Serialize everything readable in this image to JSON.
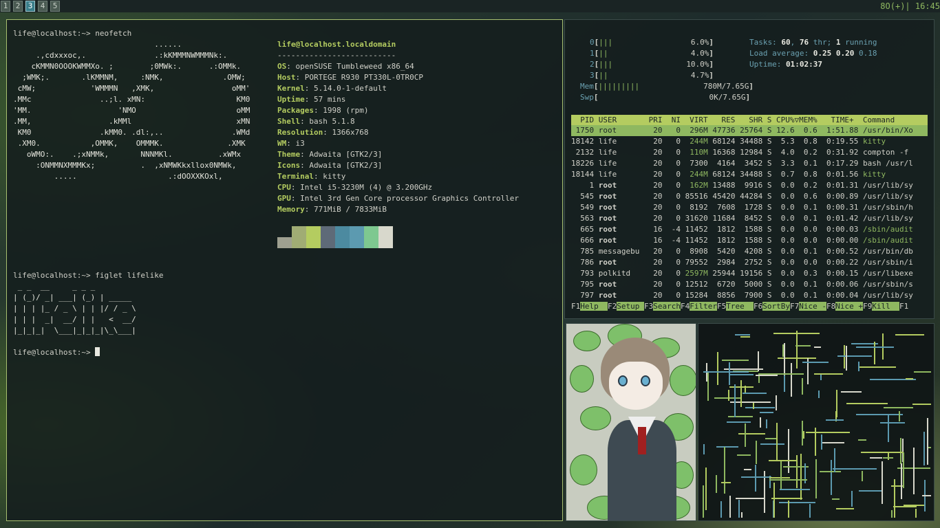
{
  "topbar": {
    "workspaces": [
      "1",
      "2",
      "3",
      "4",
      "5"
    ],
    "active_workspace": 3,
    "status": "8O(+)| 16:45"
  },
  "terminal": {
    "prompt1": "life@localhost:~> neofetch",
    "ascii_art": [
      "                               ......",
      "     .,cdxxxoc,.               .:kKMMMNWMMMNk:.",
      "    cKMMN0OOOKWMMXo. ;        ;0MWk:.      .:OMMk.",
      "  ;WMK;.       .lKMMNM,     :NMK,             .OMW;",
      " cMW;            'WMMMN   ,XMK,                 oMM'",
      ".MMc               ..;l. xMN:                    KM0",
      "'MM.                   'NMO                      oMM",
      ".MM,                 .kMMl                       xMN",
      " KM0               .kMM0. .dl:,..               .WMd",
      " .XM0.           ,OMMK,    OMMMK.              .XMK",
      "   oWMO:.    .;xNMMk,       NNNMKl.          .xWMx",
      "     :ONMMNXMMMKx;          .  ,xNMWKkxllox0NMWk,",
      "         .....                    .:dOOXXKOxl,"
    ],
    "info_title": "life@localhost.localdomain",
    "info_sep": "--------------------------",
    "info": [
      {
        "label": "OS",
        "value": "openSUSE Tumbleweed x86_64"
      },
      {
        "label": "Host",
        "value": "PORTEGE R930 PT330L-0TR0CP"
      },
      {
        "label": "Kernel",
        "value": "5.14.0-1-default"
      },
      {
        "label": "Uptime",
        "value": "57 mins"
      },
      {
        "label": "Packages",
        "value": "1998 (rpm)"
      },
      {
        "label": "Shell",
        "value": "bash 5.1.8"
      },
      {
        "label": "Resolution",
        "value": "1366x768"
      },
      {
        "label": "WM",
        "value": "i3"
      },
      {
        "label": "Theme",
        "value": "Adwaita [GTK2/3]"
      },
      {
        "label": "Icons",
        "value": "Adwaita [GTK2/3]"
      },
      {
        "label": "Terminal",
        "value": "kitty"
      },
      {
        "label": "CPU",
        "value": "Intel i5-3230M (4) @ 3.200GHz"
      },
      {
        "label": "GPU",
        "value": "Intel 3rd Gen Core processor Graphics Controller"
      },
      {
        "label": "Memory",
        "value": "771MiB / 7833MiB"
      }
    ],
    "swatches": [
      "#9ea090",
      "#a0ac74",
      "#b4cc60",
      "#5e6a78",
      "#4c8aa0",
      "#5c9ab0",
      "#7ec890",
      "#d8d8cc"
    ],
    "prompt2": "life@localhost:~> figlet lifelike",
    "figlet": [
      " _ _  __     _ _ _",
      "| (_)/ _| ___| (_) | _____",
      "| | | |_ / _ \\ | | |/ / _ \\",
      "| | |  _|  __/ | |   <  __/",
      "|_|_|_|  \\___|_|_|_|\\_\\___|"
    ],
    "prompt3": "life@localhost:~> "
  },
  "htop": {
    "cpus": [
      {
        "idx": "0",
        "bar": "|||",
        "pct": "6.0%"
      },
      {
        "idx": "1",
        "bar": "||",
        "pct": "4.0%"
      },
      {
        "idx": "2",
        "bar": "|||",
        "pct": "10.0%"
      },
      {
        "idx": "3",
        "bar": "||",
        "pct": "4.7%"
      }
    ],
    "mem": {
      "label": "Mem",
      "bar": "|||||||||",
      "value": "780M/7.65G"
    },
    "swp": {
      "label": "Swp",
      "bar": "",
      "value": "0K/7.65G"
    },
    "tasks_label": "Tasks: ",
    "tasks_a": "60",
    "tasks_sep": ", ",
    "tasks_b": "76",
    "tasks_mid": " thr; ",
    "tasks_c": "1",
    "tasks_end": " running",
    "load_label": "Load average: ",
    "load_1": "0.25",
    "load_2": "0.20",
    "load_3": "0.18",
    "uptime_label": "Uptime: ",
    "uptime": "01:02:37",
    "header": "  PID USER       PRI  NI  VIRT   RES   SHR S CPU%▽MEM%   TIME+  Command",
    "processes": [
      {
        "pid": "1750",
        "user": "root",
        "pri": "20",
        "ni": "0",
        "virt": "296M",
        "res": "47736",
        "shr": "25764",
        "s": "S",
        "cpu": "12.6",
        "mem": "0.6",
        "time": "1:51.88",
        "cmd": "/usr/bin/Xo"
      },
      {
        "pid": "18142",
        "user": "life",
        "pri": "20",
        "ni": "0",
        "virt": "244M",
        "res": "68124",
        "shr": "34488",
        "s": "S",
        "cpu": "5.3",
        "mem": "0.8",
        "time": "0:19.55",
        "cmd": "kitty"
      },
      {
        "pid": "2132",
        "user": "life",
        "pri": "20",
        "ni": "0",
        "virt": "110M",
        "res": "16368",
        "shr": "12984",
        "s": "S",
        "cpu": "4.0",
        "mem": "0.2",
        "time": "0:31.92",
        "cmd": "compton -f"
      },
      {
        "pid": "18226",
        "user": "life",
        "pri": "20",
        "ni": "0",
        "virt": "7300",
        "res": "4164",
        "shr": "3452",
        "s": "S",
        "cpu": "3.3",
        "mem": "0.1",
        "time": "0:17.29",
        "cmd": "bash /usr/l"
      },
      {
        "pid": "18144",
        "user": "life",
        "pri": "20",
        "ni": "0",
        "virt": "244M",
        "res": "68124",
        "shr": "34488",
        "s": "S",
        "cpu": "0.7",
        "mem": "0.8",
        "time": "0:01.56",
        "cmd": "kitty"
      },
      {
        "pid": "1",
        "user": "root",
        "pri": "20",
        "ni": "0",
        "virt": "162M",
        "res": "13488",
        "shr": "9916",
        "s": "S",
        "cpu": "0.0",
        "mem": "0.2",
        "time": "0:01.31",
        "cmd": "/usr/lib/sy"
      },
      {
        "pid": "545",
        "user": "root",
        "pri": "20",
        "ni": "0",
        "virt": "85516",
        "res": "45420",
        "shr": "44284",
        "s": "S",
        "cpu": "0.0",
        "mem": "0.6",
        "time": "0:00.89",
        "cmd": "/usr/lib/sy"
      },
      {
        "pid": "549",
        "user": "root",
        "pri": "20",
        "ni": "0",
        "virt": "8192",
        "res": "7608",
        "shr": "1728",
        "s": "S",
        "cpu": "0.0",
        "mem": "0.1",
        "time": "0:00.31",
        "cmd": "/usr/sbin/h"
      },
      {
        "pid": "563",
        "user": "root",
        "pri": "20",
        "ni": "0",
        "virt": "31620",
        "res": "11684",
        "shr": "8452",
        "s": "S",
        "cpu": "0.0",
        "mem": "0.1",
        "time": "0:01.42",
        "cmd": "/usr/lib/sy"
      },
      {
        "pid": "665",
        "user": "root",
        "pri": "16",
        "ni": "-4",
        "virt": "11452",
        "res": "1812",
        "shr": "1588",
        "s": "S",
        "cpu": "0.0",
        "mem": "0.0",
        "time": "0:00.03",
        "cmd": "/sbin/audit"
      },
      {
        "pid": "666",
        "user": "root",
        "pri": "16",
        "ni": "-4",
        "virt": "11452",
        "res": "1812",
        "shr": "1588",
        "s": "S",
        "cpu": "0.0",
        "mem": "0.0",
        "time": "0:00.00",
        "cmd": "/sbin/audit"
      },
      {
        "pid": "785",
        "user": "messagebu",
        "pri": "20",
        "ni": "0",
        "virt": "8908",
        "res": "5420",
        "shr": "4208",
        "s": "S",
        "cpu": "0.0",
        "mem": "0.1",
        "time": "0:00.52",
        "cmd": "/usr/bin/db"
      },
      {
        "pid": "786",
        "user": "root",
        "pri": "20",
        "ni": "0",
        "virt": "79552",
        "res": "2984",
        "shr": "2752",
        "s": "S",
        "cpu": "0.0",
        "mem": "0.0",
        "time": "0:00.22",
        "cmd": "/usr/sbin/i"
      },
      {
        "pid": "793",
        "user": "polkitd",
        "pri": "20",
        "ni": "0",
        "virt": "2597M",
        "res": "25944",
        "shr": "19156",
        "s": "S",
        "cpu": "0.0",
        "mem": "0.3",
        "time": "0:00.15",
        "cmd": "/usr/libexe"
      },
      {
        "pid": "795",
        "user": "root",
        "pri": "20",
        "ni": "0",
        "virt": "12512",
        "res": "6720",
        "shr": "5000",
        "s": "S",
        "cpu": "0.0",
        "mem": "0.1",
        "time": "0:00.06",
        "cmd": "/usr/sbin/s"
      },
      {
        "pid": "797",
        "user": "root",
        "pri": "20",
        "ni": "0",
        "virt": "15284",
        "res": "8856",
        "shr": "7900",
        "s": "S",
        "cpu": "0.0",
        "mem": "0.1",
        "time": "0:00.04",
        "cmd": "/usr/lib/sy"
      }
    ],
    "fkeys": [
      {
        "key": "F1",
        "label": "Help  "
      },
      {
        "key": "F2",
        "label": "Setup "
      },
      {
        "key": "F3",
        "label": "Search"
      },
      {
        "key": "F4",
        "label": "Filter"
      },
      {
        "key": "F5",
        "label": "Tree  "
      },
      {
        "key": "F6",
        "label": "SortBy"
      },
      {
        "key": "F7",
        "label": "Nice -"
      },
      {
        "key": "F8",
        "label": "Nice +"
      },
      {
        "key": "F9",
        "label": "Kill  "
      },
      {
        "key": "F1",
        "label": ""
      }
    ]
  }
}
